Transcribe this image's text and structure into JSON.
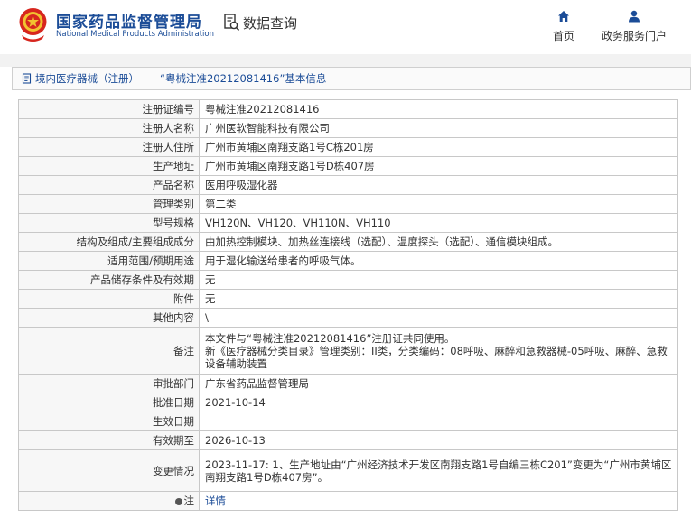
{
  "header": {
    "logo_cn": "国家药品监督管理局",
    "logo_en": "National Medical Products Administration",
    "query_label": "数据查询",
    "nav": [
      {
        "label": "首页",
        "icon": "home-icon"
      },
      {
        "label": "政务服务门户",
        "icon": "user-icon"
      }
    ]
  },
  "breadcrumb": {
    "text": "境内医疗器械（注册）——“粤械注准20212081416”基本信息"
  },
  "rows": [
    {
      "label": "注册证编号",
      "value": "粤械注准20212081416"
    },
    {
      "label": "注册人名称",
      "value": "广州医软智能科技有限公司"
    },
    {
      "label": "注册人住所",
      "value": "广州市黄埔区南翔支路1号C栋201房"
    },
    {
      "label": "生产地址",
      "value": "广州市黄埔区南翔支路1号D栋407房"
    },
    {
      "label": "产品名称",
      "value": "医用呼吸湿化器"
    },
    {
      "label": "管理类别",
      "value": "第二类"
    },
    {
      "label": "型号规格",
      "value": "VH120N、VH120、VH110N、VH110"
    },
    {
      "label": "结构及组成/主要组成成分",
      "value": "由加热控制模块、加热丝连接线（选配）、温度探头（选配）、通信模块组成。"
    },
    {
      "label": "适用范围/预期用途",
      "value": "用于湿化输送给患者的呼吸气体。"
    },
    {
      "label": "产品储存条件及有效期",
      "value": "无"
    },
    {
      "label": "附件",
      "value": "无"
    },
    {
      "label": "其他内容",
      "value": "\\"
    },
    {
      "label": "备注",
      "value": "本文件与“粤械注准20212081416”注册证共同使用。\n新《医疗器械分类目录》管理类别：II类，分类编码：08呼吸、麻醉和急救器械-05呼吸、麻醉、急救设备辅助装置"
    },
    {
      "label": "审批部门",
      "value": "广东省药品监督管理局"
    },
    {
      "label": "批准日期",
      "value": "2021-10-14"
    },
    {
      "label": "生效日期",
      "value": ""
    },
    {
      "label": "有效期至",
      "value": "2026-10-13"
    },
    {
      "label": "变更情况",
      "value": "2023-11-17: 1、生产地址由“广州经济技术开发区南翔支路1号自编三栋C201”变更为“广州市黄埔区南翔支路1号D栋407房”。"
    }
  ],
  "note": {
    "label": "注",
    "link_text": "详情"
  },
  "colors": {
    "brand_blue": "#1b4c97",
    "emblem_red": "#d7261e",
    "emblem_gold": "#f2c230"
  }
}
